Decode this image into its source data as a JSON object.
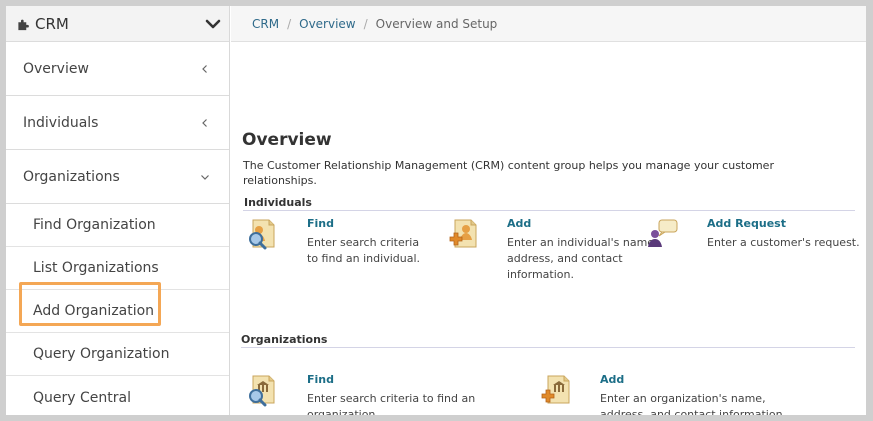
{
  "sidebar": {
    "header": {
      "title": "CRM"
    },
    "items": [
      {
        "label": "Overview"
      },
      {
        "label": "Individuals"
      },
      {
        "label": "Organizations"
      }
    ],
    "subitems": [
      {
        "label": "Find Organization"
      },
      {
        "label": "List Organizations"
      },
      {
        "label": "Add Organization"
      },
      {
        "label": "Query Organization"
      },
      {
        "label": "Query Central"
      }
    ]
  },
  "breadcrumb": {
    "items": [
      "CRM",
      "Overview",
      "Overview and Setup"
    ],
    "separator": "/"
  },
  "main": {
    "title": "Overview",
    "intro": "The Customer Relationship Management (CRM) content group helps you manage your customer relationships.",
    "individuals": {
      "heading": "Individuals",
      "actions": [
        {
          "title": "Find",
          "desc": "Enter search criteria to find an individual."
        },
        {
          "title": "Add",
          "desc": "Enter an individual's name address, and contact information."
        },
        {
          "title": "Add Request",
          "desc": "Enter a customer's request."
        }
      ]
    },
    "organizations": {
      "heading": "Organizations",
      "actions": [
        {
          "title": "Find",
          "desc": "Enter search criteria to find an organization."
        },
        {
          "title": "Add",
          "desc": "Enter an organization's name, address, and contact information."
        }
      ]
    }
  },
  "colors": {
    "accent": "#1c6e87",
    "highlight": "#f4a755",
    "link": "#2f6a8a"
  }
}
